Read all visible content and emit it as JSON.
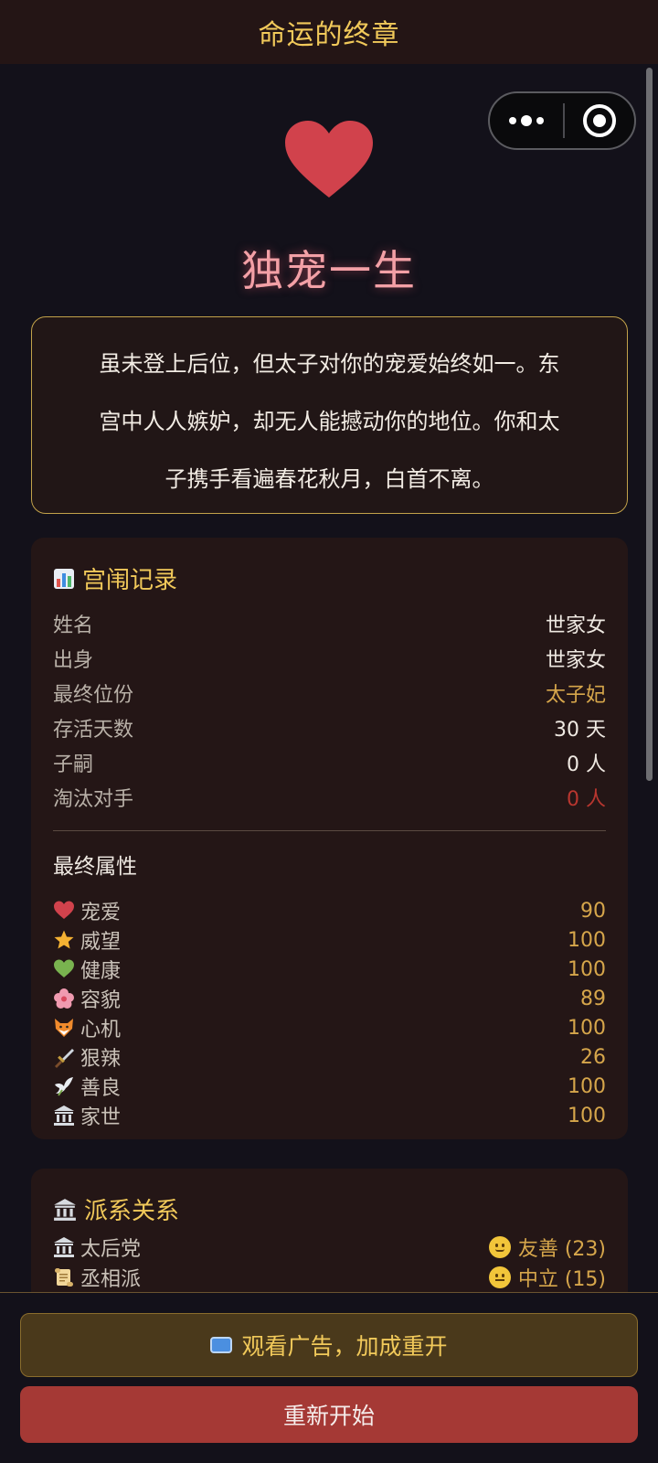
{
  "nav": {
    "title": "命运的终章"
  },
  "ending": {
    "title": "独宠一生",
    "description_lines": [
      "虽未登上后位，但太子对你的宠爱始终如一。东",
      "宫中人人嫉妒，却无人能撼动你的地位。你和太",
      "子携手看遍春花秋月，白首不离。"
    ]
  },
  "record": {
    "icon": "chart-icon",
    "title": "宫闱记录",
    "rows": [
      {
        "label": "姓名",
        "value": "世家女"
      },
      {
        "label": "出身",
        "value": "世家女"
      },
      {
        "label": "最终位份",
        "value": "太子妃"
      },
      {
        "label": "存活天数",
        "value": "30 天"
      },
      {
        "label": "子嗣",
        "value": "0 人"
      },
      {
        "label": "淘汰对手",
        "value": "0 人"
      }
    ],
    "attributes_title": "最终属性",
    "attributes": [
      {
        "icon": "heart-icon",
        "label": "宠爱",
        "value": "90"
      },
      {
        "icon": "star-icon",
        "label": "威望",
        "value": "100"
      },
      {
        "icon": "green-heart-icon",
        "label": "健康",
        "value": "100"
      },
      {
        "icon": "flower-icon",
        "label": "容貌",
        "value": "89"
      },
      {
        "icon": "fox-icon",
        "label": "心机",
        "value": "100"
      },
      {
        "icon": "dagger-icon",
        "label": "狠辣",
        "value": "26"
      },
      {
        "icon": "dove-icon",
        "label": "善良",
        "value": "100"
      },
      {
        "icon": "temple-icon",
        "label": "家世",
        "value": "100"
      }
    ]
  },
  "factions": {
    "icon": "temple-icon",
    "title": "派系关系",
    "items": [
      {
        "icon": "temple-icon",
        "label": "太后党",
        "status": "友善 (23)",
        "mood": "smile"
      },
      {
        "icon": "scroll-icon",
        "label": "丞相派",
        "status": "中立 (15)",
        "mood": "neutral"
      }
    ]
  },
  "footer": {
    "ad_button": "观看广告，加成重开",
    "restart_button": "重新开始"
  },
  "colors": {
    "gold": "#f1c95a",
    "accent_red": "#a53935",
    "value_gold": "#d6a64b"
  }
}
